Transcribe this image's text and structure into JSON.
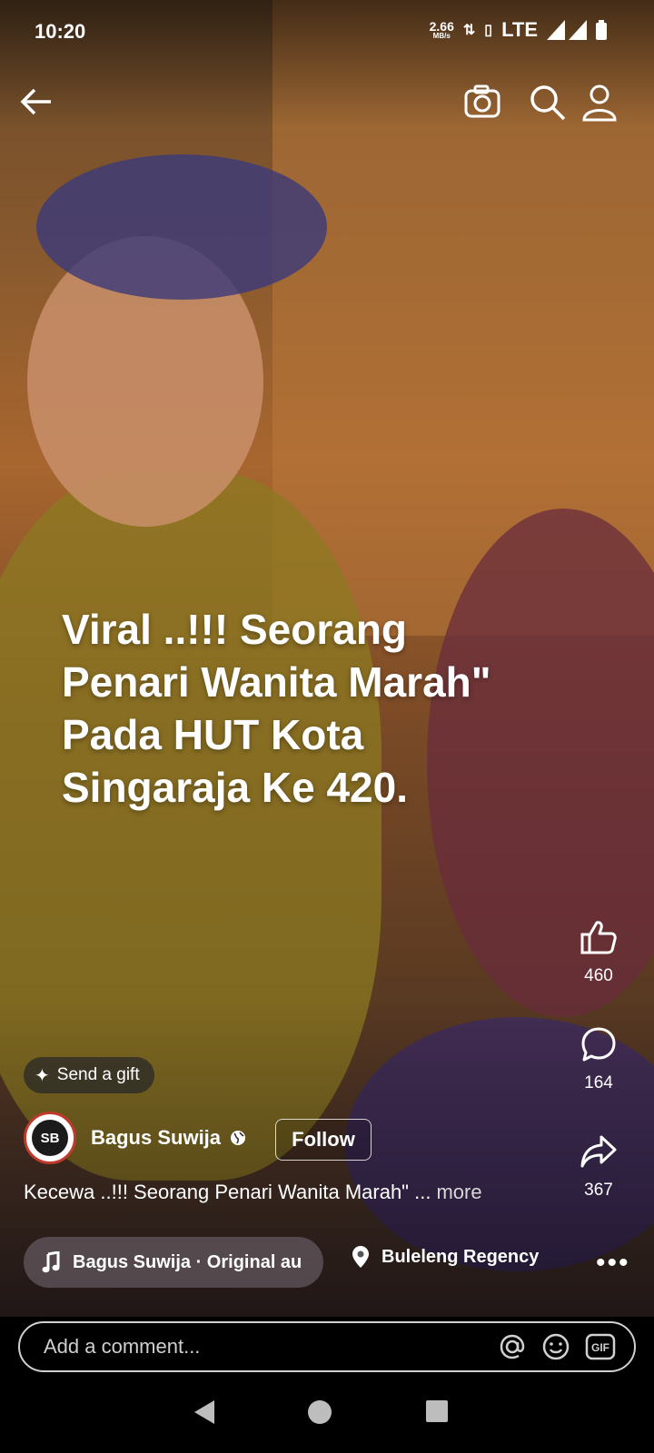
{
  "status_bar": {
    "time": "10:20",
    "net_speed": "2.66",
    "net_unit": "MB/s",
    "network": "LTE"
  },
  "top_bar": {
    "icons": [
      "back-arrow-icon",
      "camera-icon",
      "search-icon",
      "profile-icon"
    ]
  },
  "video": {
    "overlay_text": "Viral ..!!! Seorang Penari Wanita Marah\" Pada HUT Kota Singaraja Ke 420."
  },
  "actions": {
    "likes": "460",
    "comments": "164",
    "shares": "367"
  },
  "gift": {
    "label": "Send a gift"
  },
  "author": {
    "name": "Bagus Suwija",
    "follow_label": "Follow"
  },
  "caption": {
    "text": "Kecewa ..!!! Seorang Penari Wanita Marah\" ...",
    "more_label": "more"
  },
  "audio": {
    "label": "Bagus Suwija · Original au"
  },
  "location": {
    "label": "Buleleng Regency"
  },
  "comment": {
    "placeholder": "Add a comment..."
  },
  "colors": {
    "accent_follow_border": "#ffffff",
    "avatar_ring": "#c0392b"
  }
}
